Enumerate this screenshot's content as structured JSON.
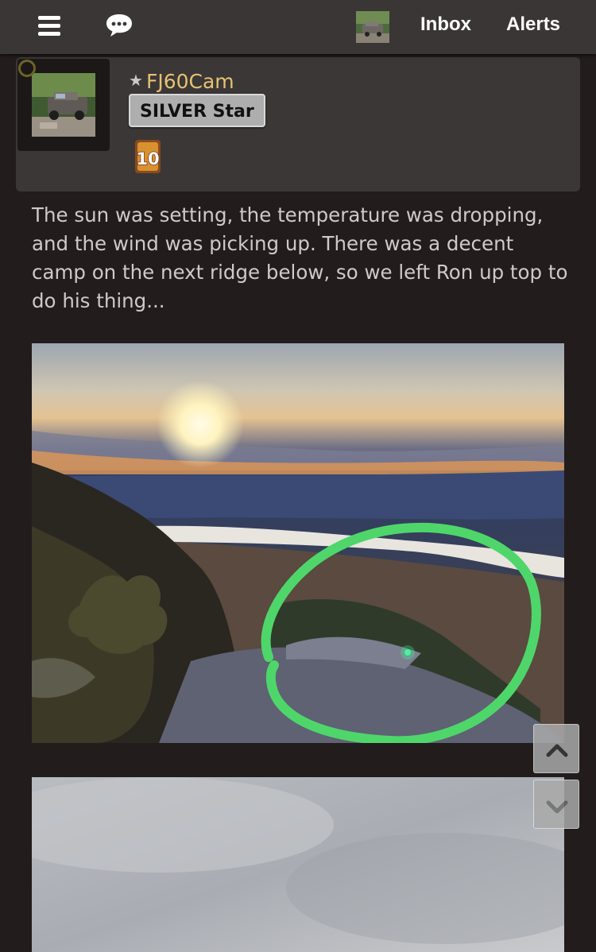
{
  "nav": {
    "menu_icon": "hamburger-icon",
    "chat_icon": "chat-bubble-icon",
    "inbox_label": "Inbox",
    "alerts_label": "Alerts"
  },
  "user": {
    "username": "FJ60Cam",
    "rank_badge": "SILVER Star",
    "years_badge": "10"
  },
  "post": {
    "text": "The sun was setting, the temperature was dropping, and the wind was picking up. There was a decent camp on the next ridge below, so we left Ron up top to do his thing..."
  },
  "colors": {
    "background": "#221c1c",
    "topbar": "#3a3636",
    "username": "#e6c271",
    "highlight_circle": "#4fd66a"
  },
  "scroll": {
    "up_icon": "chevron-up-icon",
    "down_icon": "chevron-down-icon"
  }
}
